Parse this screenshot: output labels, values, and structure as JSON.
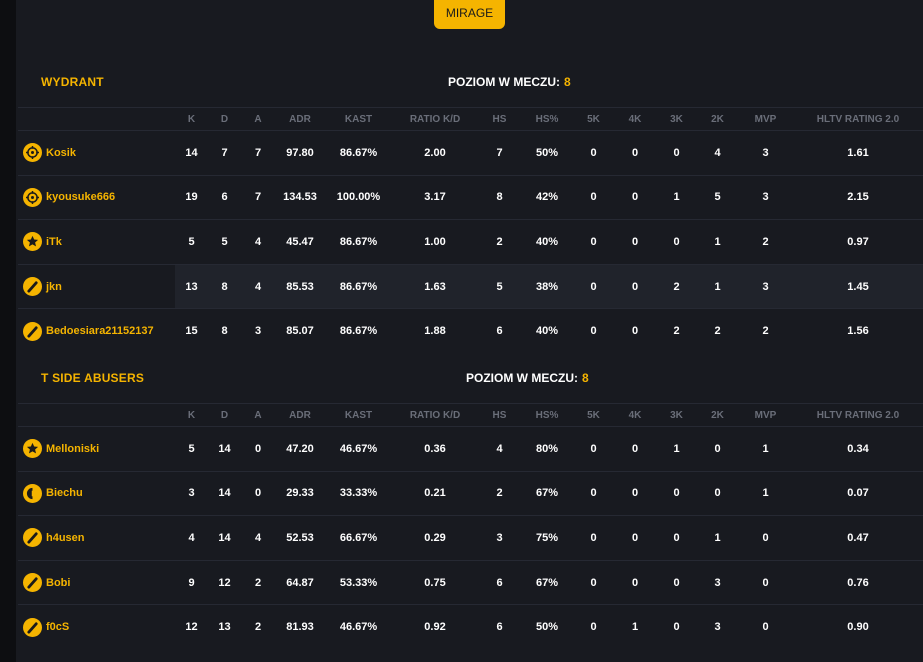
{
  "map_button": "MIRAGE",
  "columns": [
    "K",
    "D",
    "A",
    "ADR",
    "KAST",
    "RATIO K/D",
    "HS",
    "HS%",
    "5K",
    "4K",
    "3K",
    "2K",
    "MVP",
    "HLTV RATING 2.0"
  ],
  "teams": [
    {
      "name": "WYDRANT",
      "level_label": "POZIOM W MECZU:",
      "level_value": "8",
      "players": [
        {
          "name": "Kosik",
          "icon": "crosshair-level-icon",
          "stats": [
            "14",
            "7",
            "7",
            "97.80",
            "86.67%",
            "2.00",
            "7",
            "50%",
            "0",
            "0",
            "0",
            "4",
            "3",
            "1.61"
          ]
        },
        {
          "name": "kyousuke666",
          "icon": "crosshair-level-icon",
          "stats": [
            "19",
            "6",
            "7",
            "134.53",
            "100.00%",
            "3.17",
            "8",
            "42%",
            "0",
            "0",
            "1",
            "5",
            "3",
            "2.15"
          ]
        },
        {
          "name": "iTk",
          "icon": "star-level-icon",
          "stats": [
            "5",
            "5",
            "4",
            "45.47",
            "86.67%",
            "1.00",
            "2",
            "40%",
            "0",
            "0",
            "0",
            "1",
            "2",
            "0.97"
          ]
        },
        {
          "name": "jkn",
          "icon": "slash-level-icon",
          "stats": [
            "13",
            "8",
            "4",
            "85.53",
            "86.67%",
            "1.63",
            "5",
            "38%",
            "0",
            "0",
            "2",
            "1",
            "3",
            "1.45"
          ]
        },
        {
          "name": "Bedoesiara21152137",
          "icon": "slash-level-icon",
          "stats": [
            "15",
            "8",
            "3",
            "85.07",
            "86.67%",
            "1.88",
            "6",
            "40%",
            "0",
            "0",
            "2",
            "2",
            "2",
            "1.56"
          ]
        }
      ]
    },
    {
      "name": "T SIDE ABUSERS",
      "level_label": "POZIOM W MECZU:",
      "level_value": "8",
      "players": [
        {
          "name": "Melloniski",
          "icon": "star-level-icon",
          "stats": [
            "5",
            "14",
            "0",
            "47.20",
            "46.67%",
            "0.36",
            "4",
            "80%",
            "0",
            "0",
            "1",
            "0",
            "1",
            "0.34"
          ]
        },
        {
          "name": "Biechu",
          "icon": "half-level-icon",
          "stats": [
            "3",
            "14",
            "0",
            "29.33",
            "33.33%",
            "0.21",
            "2",
            "67%",
            "0",
            "0",
            "0",
            "0",
            "1",
            "0.07"
          ]
        },
        {
          "name": "h4usen",
          "icon": "slash-level-icon",
          "stats": [
            "4",
            "14",
            "4",
            "52.53",
            "66.67%",
            "0.29",
            "3",
            "75%",
            "0",
            "0",
            "0",
            "1",
            "0",
            "0.47"
          ]
        },
        {
          "name": "Bobi",
          "icon": "slash-level-icon",
          "stats": [
            "9",
            "12",
            "2",
            "64.87",
            "53.33%",
            "0.75",
            "6",
            "67%",
            "0",
            "0",
            "0",
            "3",
            "0",
            "0.76"
          ]
        },
        {
          "name": "f0cS",
          "icon": "slash-level-icon",
          "stats": [
            "12",
            "13",
            "2",
            "81.93",
            "46.67%",
            "0.92",
            "6",
            "50%",
            "0",
            "1",
            "0",
            "3",
            "0",
            "0.90"
          ]
        }
      ]
    }
  ],
  "colors": {
    "accent": "#f5b400",
    "background": "#181a20",
    "header_text": "#6a6e79"
  }
}
